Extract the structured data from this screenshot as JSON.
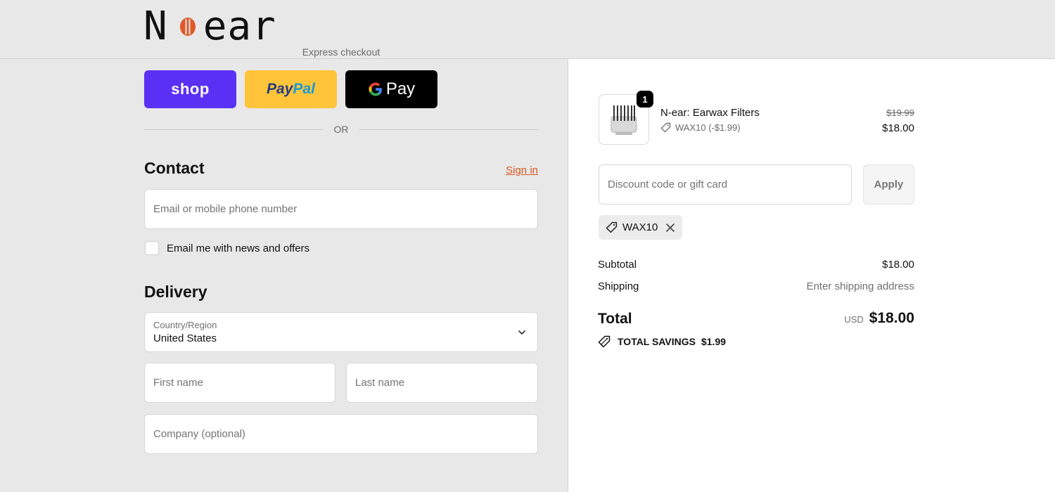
{
  "brand": {
    "logo_left": "N",
    "logo_right": "ear"
  },
  "express": {
    "label": "Express checkout",
    "shop_label": "shop",
    "paypal_part1": "Pay",
    "paypal_part2": "Pal",
    "gpay_label": "Pay",
    "or_label": "OR"
  },
  "contact": {
    "title": "Contact",
    "sign_in": "Sign in",
    "email_placeholder": "Email or mobile phone number",
    "newsletter_label": "Email me with news and offers"
  },
  "delivery": {
    "title": "Delivery",
    "country_caption": "Country/Region",
    "country_value": "United States",
    "first_name_placeholder": "First name",
    "last_name_placeholder": "Last name",
    "company_placeholder": "Company (optional)"
  },
  "order": {
    "item": {
      "quantity": "1",
      "name": "N-ear: Earwax Filters",
      "discount_label": "WAX10 (-$1.99)",
      "original_price": "$19.99",
      "price": "$18.00"
    },
    "discount_placeholder": "Discount code or gift card",
    "apply_label": "Apply",
    "applied_code": "WAX10",
    "subtotal_label": "Subtotal",
    "subtotal_value": "$18.00",
    "shipping_label": "Shipping",
    "shipping_value": "Enter shipping address",
    "total_label": "Total",
    "total_currency": "USD",
    "total_value": "$18.00",
    "savings_label": "TOTAL SAVINGS",
    "savings_value": "$1.99"
  },
  "colors": {
    "shop_purple": "#5a31f4",
    "paypal_yellow": "#ffc439",
    "link_orange": "#d9541f",
    "logo_mark_orange": "#e0592a"
  }
}
